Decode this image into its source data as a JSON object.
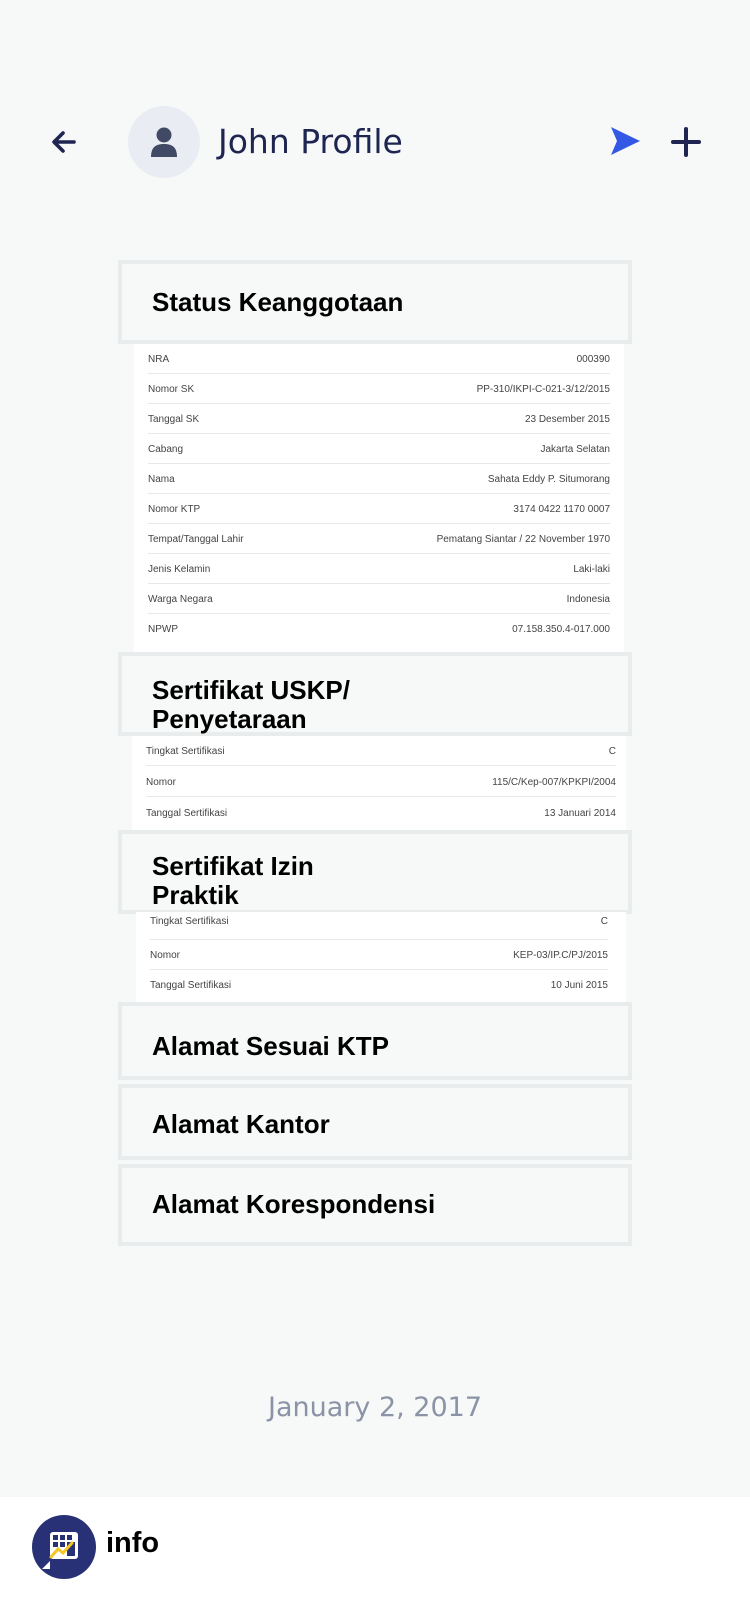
{
  "header": {
    "title": "John Profile",
    "back_icon": "arrow-left-icon",
    "avatar_icon": "user-icon",
    "send_icon": "send-icon",
    "add_icon": "plus-icon",
    "accent": "#3358e6",
    "navy": "#1e2550"
  },
  "sections": {
    "status": {
      "title": "Status Keanggotaan",
      "rows": [
        {
          "label": "NRA",
          "value": "000390"
        },
        {
          "label": "Nomor SK",
          "value": "PP-310/IKPI-C-021-3/12/2015"
        },
        {
          "label": "Tanggal SK",
          "value": "23 Desember 2015"
        },
        {
          "label": "Cabang",
          "value": "Jakarta Selatan"
        },
        {
          "label": "Nama",
          "value": "Sahata Eddy P. Situmorang"
        },
        {
          "label": "Nomor KTP",
          "value": "3174 0422 1170 0007"
        },
        {
          "label": "Tempat/Tanggal Lahir",
          "value": "Pematang Siantar / 22 November 1970"
        },
        {
          "label": "Jenis Kelamin",
          "value": "Laki-laki"
        },
        {
          "label": "Warga Negara",
          "value": "Indonesia"
        },
        {
          "label": "NPWP",
          "value": "07.158.350.4-017.000"
        }
      ]
    },
    "uskp": {
      "title_line1": "Sertifikat USKP/",
      "title_line2": "Penyetaraan",
      "rows": [
        {
          "label": "Tingkat Sertifikasi",
          "value": "C"
        },
        {
          "label": "Nomor",
          "value": "115/C/Kep-007/KPKPI/2004"
        },
        {
          "label": "Tanggal Sertifikasi",
          "value": "13 Januari 2014"
        }
      ]
    },
    "izin": {
      "title_line1": "Sertifikat Izin",
      "title_line2": "Praktik",
      "rows": [
        {
          "label": "Tingkat Sertifikasi",
          "value": "C"
        },
        {
          "label": "Nomor",
          "value": "KEP-03/IP.C/PJ/2015"
        },
        {
          "label": "Tanggal Sertifikasi",
          "value": "10 Juni 2015"
        }
      ]
    },
    "alamat_ktp": {
      "title": "Alamat Sesuai KTP"
    },
    "alamat_kantor": {
      "title": "Alamat Kantor"
    },
    "alamat_koresp": {
      "title": "Alamat Korespondensi"
    }
  },
  "footer": {
    "date": "January 2, 2017",
    "app_label": "info",
    "logo_icon": "app-logo-icon"
  }
}
